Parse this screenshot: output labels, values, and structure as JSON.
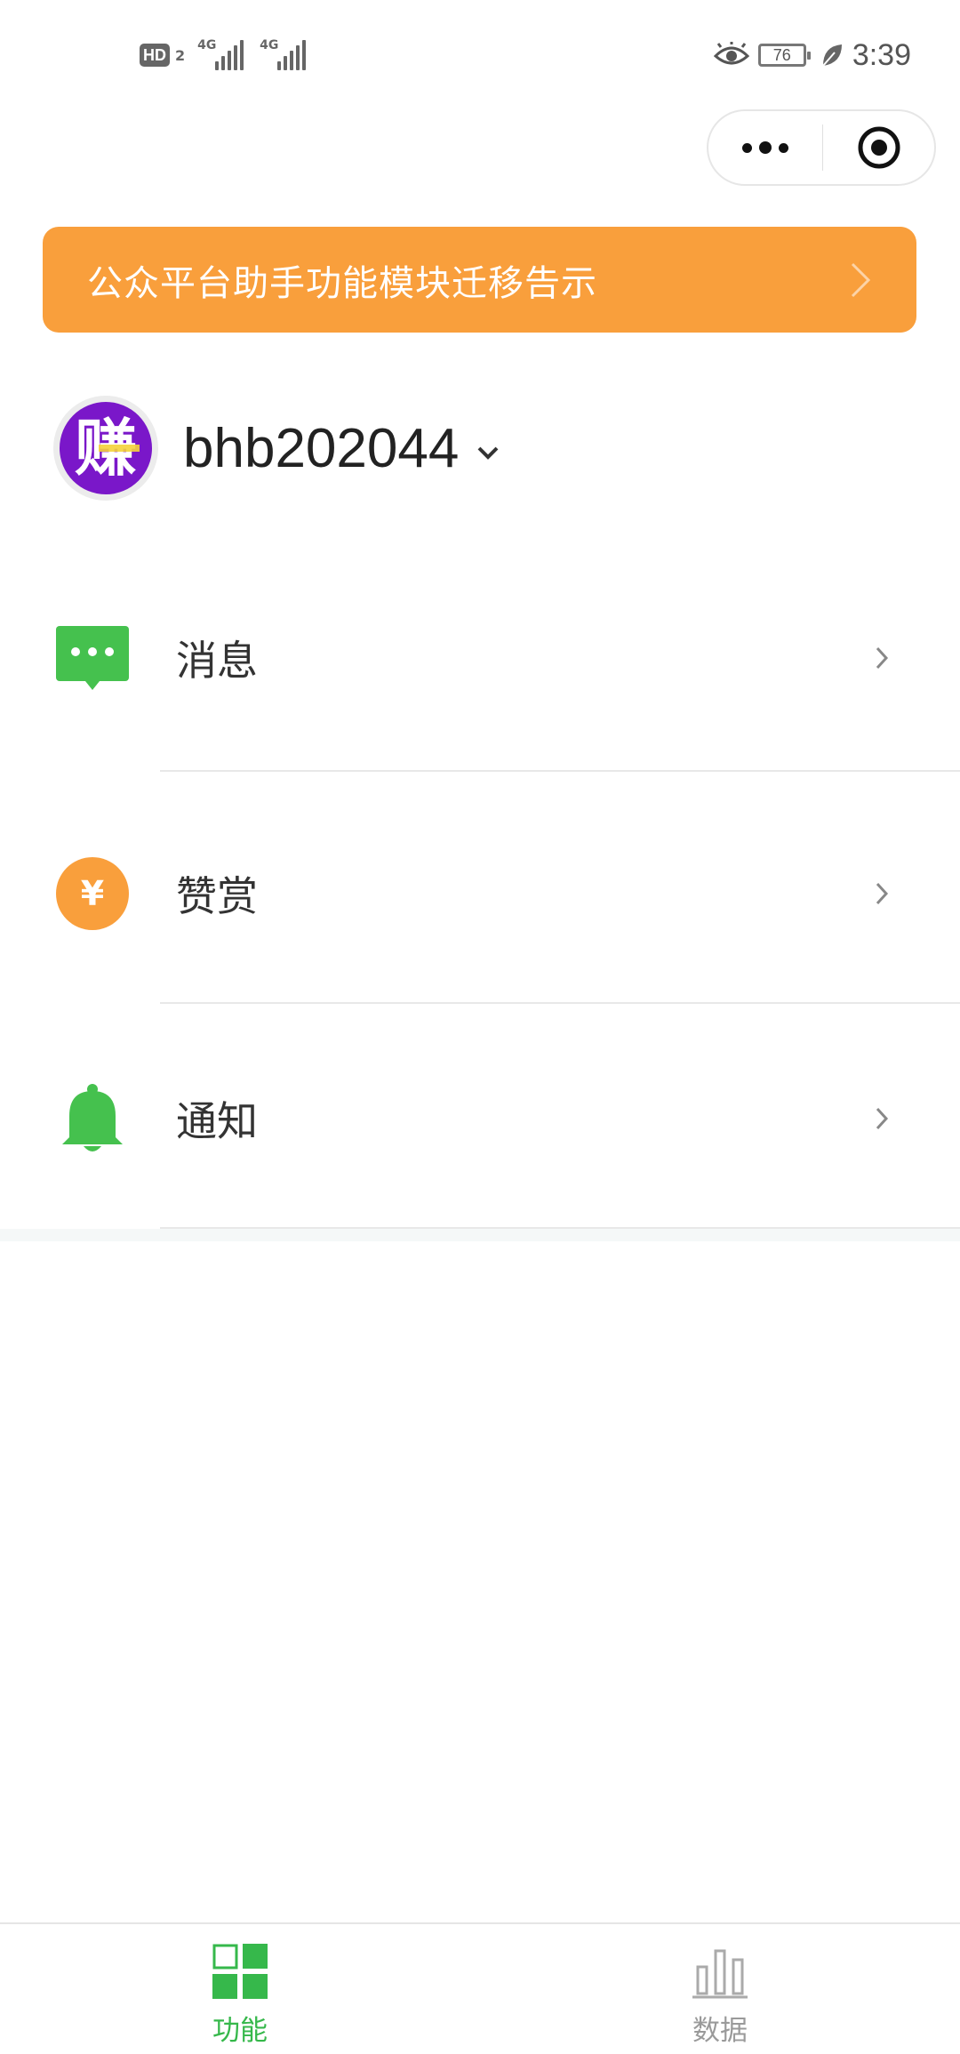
{
  "status_bar": {
    "hd_label": "HD",
    "sim_number": "2",
    "network_1": "4G",
    "network_2": "4G",
    "battery_level": "76",
    "time": "3:39",
    "icons": [
      "eye-icon",
      "leaf-icon"
    ]
  },
  "capsule": {
    "more_icon": "more-dots-icon",
    "close_icon": "target-circle-icon"
  },
  "notice": {
    "text": "公众平台助手功能模块迁移告示"
  },
  "account": {
    "avatar_text": "赚",
    "name": "bhb202044"
  },
  "menu": {
    "items": [
      {
        "label": "消息",
        "icon": "message-icon"
      },
      {
        "label": "赞赏",
        "icon": "yen-coin-icon"
      },
      {
        "label": "通知",
        "icon": "bell-icon"
      }
    ]
  },
  "tabbar": {
    "tabs": [
      {
        "label": "功能",
        "icon": "grid-icon",
        "active": true
      },
      {
        "label": "数据",
        "icon": "bar-chart-icon",
        "active": false
      }
    ]
  },
  "colors": {
    "accent_green": "#36b84b",
    "notice_orange": "#f99f3c",
    "avatar_purple": "#7a17c9"
  }
}
